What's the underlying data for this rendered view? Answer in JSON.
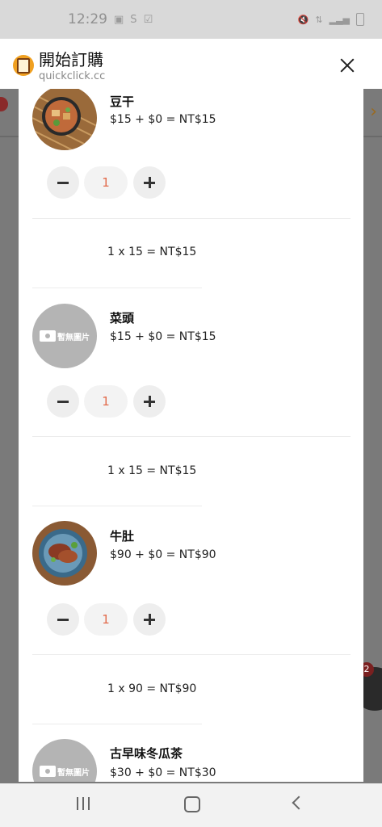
{
  "status": {
    "time": "12:29"
  },
  "header": {
    "title": "開始訂購",
    "url": "quickclick.cc"
  },
  "items": [
    {
      "name": "豆干",
      "price": "$15 + $0 = NT$15",
      "qty": "1",
      "subtotal": "1 x 15 = NT$15",
      "image": "photo"
    },
    {
      "name": "菜頭",
      "price": "$15 + $0 = NT$15",
      "qty": "1",
      "subtotal": "1 x 15 = NT$15",
      "image": "placeholder",
      "placeholder_text": "暫無圖片"
    },
    {
      "name": "牛肚",
      "price": "$90 + $0 = NT$90",
      "qty": "1",
      "subtotal": "1 x 90 = NT$90",
      "image": "photo"
    },
    {
      "name": "古早味冬瓜茶",
      "price": "$30 + $0 = NT$30",
      "image": "placeholder",
      "placeholder_text": "暫無圖片"
    }
  ],
  "background": {
    "cart_badge": "2"
  }
}
